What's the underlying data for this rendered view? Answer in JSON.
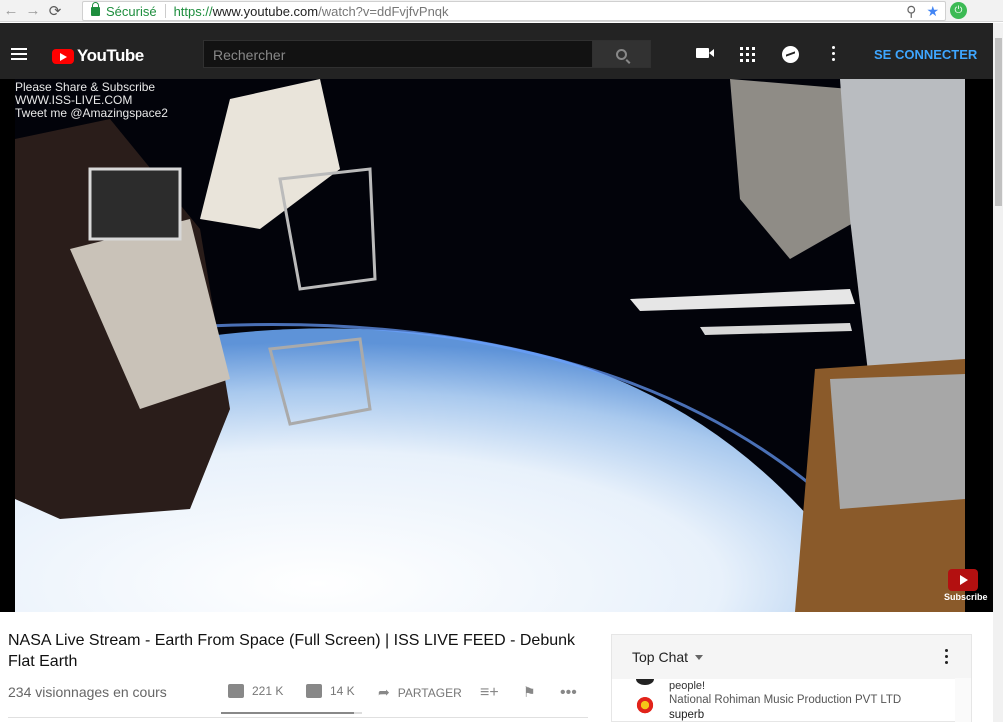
{
  "browser": {
    "secure_label": "Sécurisé",
    "url_scheme": "https://",
    "url_host": "www.youtube.com",
    "url_path": "/watch?v=ddFvjfvPnqk"
  },
  "header": {
    "logo_text": "YouTube",
    "search_placeholder": "Rechercher",
    "signin_label": "SE CONNECTER"
  },
  "video": {
    "overlay_lines": [
      "Please Share & Subscribe",
      "WWW.ISS-LIVE.COM",
      "Tweet me @Amazingspace2"
    ],
    "subscribe_badge": "Subscribe"
  },
  "info": {
    "title": "NASA Live Stream - Earth From Space (Full Screen) | ISS LIVE FEED - Debunk Flat Earth",
    "views": "234 visionnages en cours",
    "likes": "221 K",
    "dislikes": "14 K",
    "share_label": "PARTAGER",
    "like_ratio": 0.94
  },
  "chat": {
    "mode_label": "Top Chat",
    "prev_message_tail": "people!",
    "messages": [
      {
        "author": "National Rohiman Music Production PVT LTD",
        "text": "superb"
      }
    ]
  },
  "icons": {
    "back": "back-arrow-icon",
    "forward": "forward-arrow-icon",
    "reload": "reload-icon",
    "zoom": "zoom-icon",
    "bookmark": "star-icon",
    "menu": "hamburger-icon",
    "upload": "video-camera-icon",
    "apps": "apps-grid-icon",
    "messages": "messages-icon",
    "more": "more-vert-icon"
  }
}
